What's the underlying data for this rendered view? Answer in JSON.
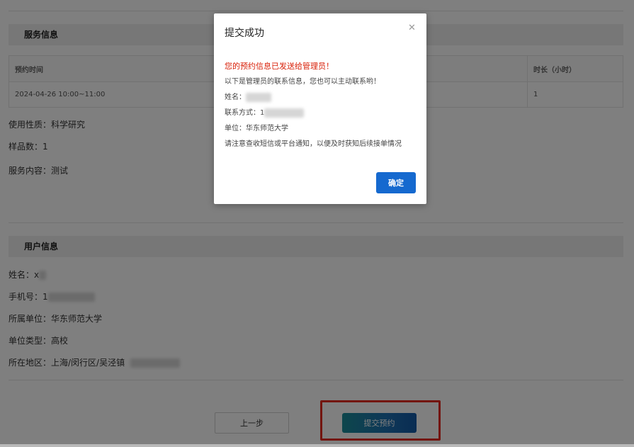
{
  "service_section": {
    "title": "服务信息",
    "table": {
      "headers": [
        "预约时间",
        "时长（小时）"
      ],
      "rows": [
        [
          "2024-04-26 10:00~11:00",
          "1"
        ]
      ]
    },
    "usage_label": "使用性质：",
    "usage_value": "科学研究",
    "sample_label": "样品数：",
    "sample_value": "1",
    "content_label": "服务内容：",
    "content_value": "测试"
  },
  "user_section": {
    "title": "用户信息",
    "name_label": "姓名：",
    "name_value": "x",
    "phone_label": "手机号：",
    "phone_value": "1",
    "org_label": "所属单位：",
    "org_value": "华东师范大学",
    "org_type_label": "单位类型：",
    "org_type_value": "高校",
    "region_label": "所在地区：",
    "region_value": "上海/闵行区/吴泾镇"
  },
  "actions": {
    "prev_label": "上一步",
    "submit_label": "提交预约"
  },
  "modal": {
    "title": "提交成功",
    "close_icon": "close-icon",
    "alert": "您的预约信息已发送给管理员！",
    "intro": "以下是管理员的联系信息，您也可以主动联系哟！",
    "name_label": "姓名：",
    "contact_label": "联系方式：1",
    "org_label": "单位：",
    "org_value": "华东师范大学",
    "notice": "请注意查收短信或平台通知，以便及时获知后续接单情况",
    "ok_label": "确定"
  },
  "colors": {
    "primary": "#1569cf",
    "alert_red": "#d81e06",
    "highlight_red": "#e62a1f",
    "section_header_bg": "#efefef"
  }
}
